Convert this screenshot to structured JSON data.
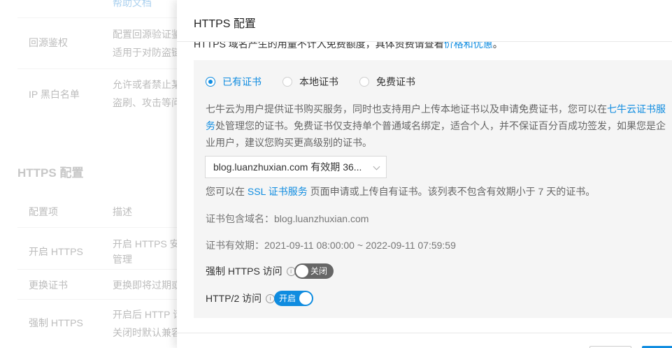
{
  "background": {
    "help_link": "帮助文档",
    "rows_top": [
      {
        "label": "回源鉴权",
        "desc_line1": "配置回源验证鉴",
        "desc_line2": "适用于对防盗链"
      },
      {
        "label": "IP 黑白名单",
        "desc_line1": "允许或者禁止某",
        "desc_line2": "盗刷、攻击等问"
      }
    ],
    "section_title": "HTTPS 配置",
    "table_header": {
      "col1": "配置项",
      "col2": "描述"
    },
    "rows_bottom": [
      {
        "label": "开启 HTTPS",
        "desc_line1": "开启 HTTPS 安",
        "desc_line2": "管理"
      },
      {
        "label": "更换证书",
        "desc_line1": "更换即将过期或",
        "desc_line2": ""
      },
      {
        "label": "强制 HTTPS",
        "desc_line1": "开启后 HTTP 请",
        "desc_line2": "关闭时默认兼容"
      }
    ]
  },
  "drawer": {
    "title": "HTTPS 配置",
    "top_note": "HTTPS 域名产生的用量不计入免费额度，具体资费请查看",
    "top_note_link": "价格和优惠",
    "top_note_end": "。",
    "radios": [
      {
        "label": "已有证书",
        "checked": true
      },
      {
        "label": "本地证书",
        "checked": false
      },
      {
        "label": "免费证书",
        "checked": false
      }
    ],
    "desc_part1": "七牛云为用户提供证书购买服务，同时也支持用户上传本地证书以及申请免费证书，您可以在",
    "desc_link": "七牛云证书服务",
    "desc_part2": "处管理您的证书。免费证书仅支持单个普通域名绑定，适合个人，并不保证百分百成功签发，如果您是企业用户，建议您购买更高级别的证书。",
    "cert_select_value": "blog.luanzhuxian.com 有效期 36...",
    "hint_part1": "您可以在",
    "hint_link": "SSL 证书服务",
    "hint_part2": "页面申请或上传自有证书。该列表不包含有效期小于 7 天的证书。",
    "cert_domain": "证书包含域名：blog.luanzhuxian.com",
    "cert_validity": "证书有效期：2021-09-11 08:00:00 ~ 2022-09-11 07:59:59",
    "force_https_label": "强制 HTTPS 访问",
    "force_https_state": "关闭",
    "http2_label": "HTTP/2 访问",
    "http2_state": "开启",
    "info_icon_glyph": "i"
  },
  "colors": {
    "accent": "#0f8ce0",
    "switch_off": "#666666"
  }
}
